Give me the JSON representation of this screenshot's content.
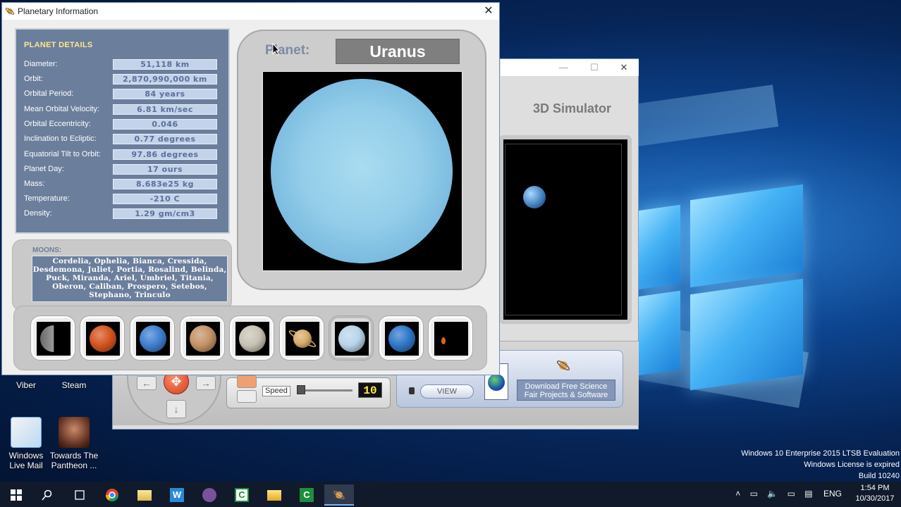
{
  "info_window": {
    "title": "Planetary Information",
    "close_glyph": "✕"
  },
  "details": {
    "heading": "PLANET DETAILS",
    "rows": [
      {
        "label": "Diameter:",
        "value": "51,118 km"
      },
      {
        "label": "Orbit:",
        "value": "2,870,990,000 km"
      },
      {
        "label": "Orbital Period:",
        "value": "84 years"
      },
      {
        "label": "Mean Orbital Velocity:",
        "value": "6.81 km/sec"
      },
      {
        "label": "Orbital  Eccentricity:",
        "value": "0.046"
      },
      {
        "label": "Inclination to Ecliptic:",
        "value": "0.77 degrees"
      },
      {
        "label": "Equatorial Tilt to Orbit:",
        "value": "97.86 degrees"
      },
      {
        "label": "Planet Day:",
        "value": "17 ours"
      },
      {
        "label": "Mass:",
        "value": "8.683e25 kg"
      },
      {
        "label": "Temperature:",
        "value": "-210 C"
      },
      {
        "label": "Density:",
        "value": "1.29 gm/cm3"
      }
    ]
  },
  "moons": {
    "heading": "MOONS:",
    "text": "Cordelia, Ophelia, Bianca, Cressida, Desdemona, Juliet, Portia, Rosalind, Belinda, Puck, Miranda, Ariel, Umbriel, Titania, Oberon, Caliban, Prospero, Setebos, Stephano, Trinculo"
  },
  "viewer": {
    "label": "Planet:",
    "planet_name": "Uranus",
    "planet_color": "#93cde9"
  },
  "planet_thumbnails": [
    {
      "name": "Mercury",
      "icon": "mercury-icon",
      "color": "#8c8c8c"
    },
    {
      "name": "Venus",
      "icon": "venus-icon",
      "color": "#d4551e"
    },
    {
      "name": "Earth",
      "icon": "earth-icon",
      "color": "#3f7fd0"
    },
    {
      "name": "Mars",
      "icon": "mars-icon",
      "color": "#c49366"
    },
    {
      "name": "Jupiter",
      "icon": "jupiter-icon",
      "color": "#c8c2b4"
    },
    {
      "name": "Saturn",
      "icon": "saturn-icon",
      "color": "#d8ad6a"
    },
    {
      "name": "Uranus",
      "icon": "uranus-icon",
      "color": "#b8d4ea",
      "selected": true
    },
    {
      "name": "Neptune",
      "icon": "neptune-icon",
      "color": "#2f77c9"
    },
    {
      "name": "Pluto",
      "icon": "pluto-icon",
      "color": "#d8681e"
    }
  ],
  "simulator": {
    "title": "3D Simulator",
    "speed_label": "Speed",
    "speed_value": "10",
    "view_button": "VIEW",
    "download_text": "Download Free Science Fair Projects & Software",
    "nav_center_glyph": "✥"
  },
  "desktop_icons": [
    {
      "label": "Viber"
    },
    {
      "label": "Steam"
    },
    {
      "label": "Windows Live Mail"
    },
    {
      "label": "Towards The Pantheon ..."
    }
  ],
  "watermark": {
    "line1": "Windows 10 Enterprise 2015 LTSB Evaluation",
    "line2": "Windows License is expired",
    "line3": "Build 10240"
  },
  "taskbar": {
    "language": "ENG",
    "time": "1:54 PM",
    "date": "10/30/2017"
  },
  "colors": {
    "details_panel": "#6b7e9c",
    "details_heading": "#ffe98a",
    "value_field": "#c3d3ea"
  }
}
